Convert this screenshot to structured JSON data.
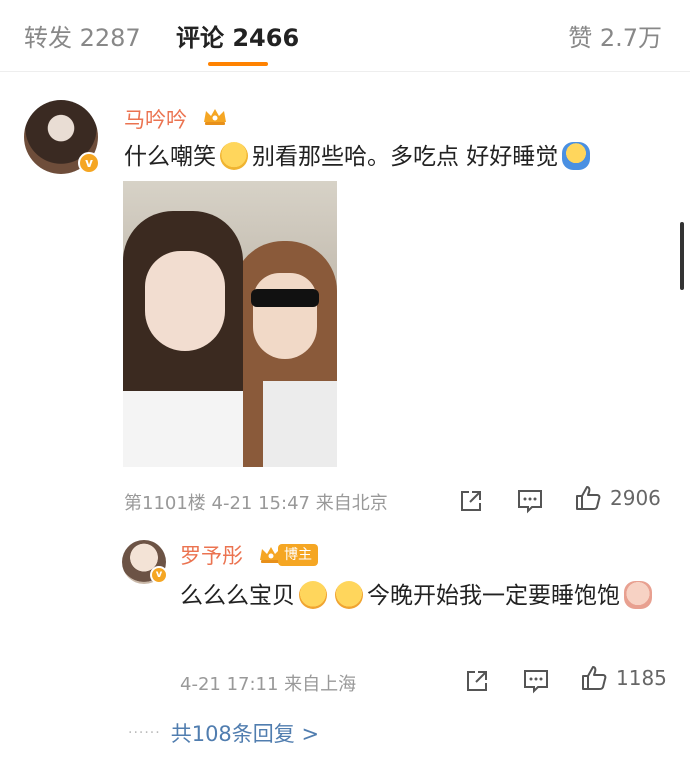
{
  "tabs": {
    "repost_label": "转发 2287",
    "comments_label": "评论 2466",
    "likes_label": "赞 2.7万",
    "accent_color": "#ff8200"
  },
  "main_comment": {
    "username": "马吟吟",
    "text_part1": "什么嘲笑",
    "text_part2": "别看那些哈。多吃点 好好睡觉",
    "meta": "第1101楼 4-21 15:47 来自北京",
    "like_count": "2906",
    "verified_icon": "v"
  },
  "reply": {
    "username": "罗予彤",
    "author_badge": "博主",
    "text_part1": "么么么宝贝",
    "text_part2": "今晚开始我一定要睡饱饱",
    "meta": "4-21 17:11 来自上海",
    "like_count": "1185",
    "verified_icon": "v"
  },
  "more_replies": {
    "dots": "······",
    "label": "共108条回复 >"
  },
  "colors": {
    "username": "#eb7350",
    "link": "#507daf",
    "meta": "#999999"
  }
}
